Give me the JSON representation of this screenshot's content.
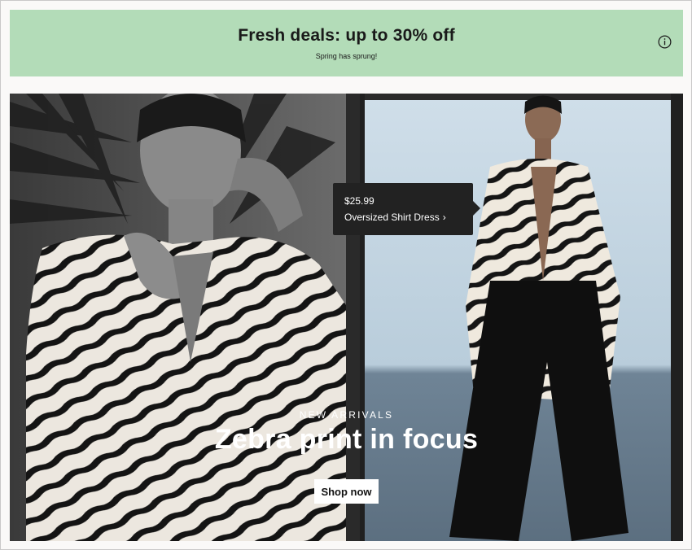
{
  "promo": {
    "title": "Fresh deals: up to 30% off",
    "subtitle": "Spring has sprung!",
    "info_icon": "info-icon",
    "background_color": "#b3dcb8"
  },
  "hero": {
    "product_tag": {
      "price": "$25.99",
      "name": "Oversized Shirt Dress",
      "chevron": "›"
    },
    "eyebrow": "NEW ARRIVALS",
    "headline": "Zebra print in focus",
    "cta_label": "Shop now"
  }
}
